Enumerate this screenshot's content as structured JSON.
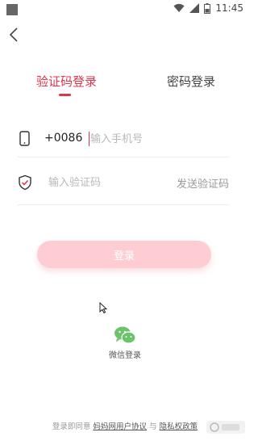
{
  "status_bar": {
    "time": "11:45"
  },
  "tabs": [
    {
      "label": "验证码登录",
      "active": true
    },
    {
      "label": "密码登录",
      "active": false
    }
  ],
  "phone_row": {
    "country_code": "+0086",
    "placeholder": "输入手机号",
    "value": ""
  },
  "code_row": {
    "placeholder": "输入验证码",
    "value": "",
    "send_label": "发送验证码"
  },
  "login_button": {
    "label": "登录"
  },
  "wechat": {
    "label": "微信登录"
  },
  "footer": {
    "prefix": "登录即同意",
    "user_agreement": "妈妈网用户协议",
    "conjunction": "与",
    "privacy_policy": "隐私权政策"
  },
  "colors": {
    "accent": "#e0344a",
    "button_bg": "#fdcdd3",
    "wechat": "#6cc36c"
  },
  "icons": [
    "back-arrow-icon",
    "phone-icon",
    "shield-check-icon",
    "wechat-icon",
    "wifi-icon",
    "signal-icon",
    "battery-icon"
  ]
}
